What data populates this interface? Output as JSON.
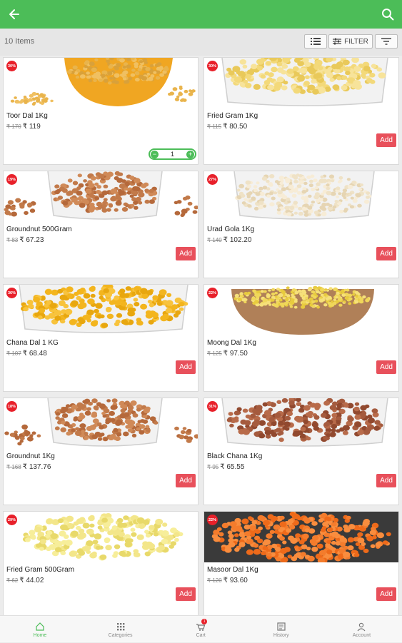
{
  "header": {
    "title": ""
  },
  "toolbar": {
    "count": "10 Items",
    "filter_label": "FILTER"
  },
  "products": [
    {
      "name": "Toor Dal 1Kg",
      "discount": "30%",
      "mrp": "₹ 170",
      "price": "₹ 119",
      "action": "stepper",
      "quantity": "1",
      "img": "toor"
    },
    {
      "name": "Fried Gram 1Kg",
      "discount": "30%",
      "mrp": "₹ 115",
      "price": "₹ 80.50",
      "action": "Add",
      "img": "friedgram"
    },
    {
      "name": "Groundnut 500Gram",
      "discount": "19%",
      "mrp": "₹ 83",
      "price": "₹ 67.23",
      "action": "Add",
      "img": "groundnut"
    },
    {
      "name": "Urad Gola 1Kg",
      "discount": "27%",
      "mrp": "₹ 140",
      "price": "₹ 102.20",
      "action": "Add",
      "img": "urad"
    },
    {
      "name": "Chana Dal 1 KG",
      "discount": "36%",
      "mrp": "₹ 107",
      "price": "₹ 68.48",
      "action": "Add",
      "img": "chana"
    },
    {
      "name": "Moong Dal 1Kg",
      "discount": "22%",
      "mrp": "₹ 125",
      "price": "₹ 97.50",
      "action": "Add",
      "img": "moong"
    },
    {
      "name": "Groundnut 1Kg",
      "discount": "18%",
      "mrp": "₹ 168",
      "price": "₹ 137.76",
      "action": "Add",
      "img": "groundnut"
    },
    {
      "name": "Black Chana 1Kg",
      "discount": "31%",
      "mrp": "₹ 95",
      "price": "₹ 65.55",
      "action": "Add",
      "img": "blackchana"
    },
    {
      "name": "Fried Gram 500Gram",
      "discount": "29%",
      "mrp": "₹ 62",
      "price": "₹ 44.02",
      "action": "Add",
      "img": "friedgram2"
    },
    {
      "name": "Masoor Dal 1Kg",
      "discount": "22%",
      "mrp": "₹ 120",
      "price": "₹ 93.60",
      "action": "Add",
      "img": "masoor"
    }
  ],
  "bottom_nav": [
    {
      "label": "Home",
      "icon": "home-icon",
      "active": true
    },
    {
      "label": "Categories",
      "icon": "categories-icon"
    },
    {
      "label": "Cart",
      "icon": "cart-icon",
      "badge": "1"
    },
    {
      "label": "History",
      "icon": "history-icon"
    },
    {
      "label": "Account",
      "icon": "account-icon"
    }
  ],
  "colors": {
    "primary": "#4cbd58",
    "add_button": "#e8505b",
    "badge": "#e8202a"
  }
}
